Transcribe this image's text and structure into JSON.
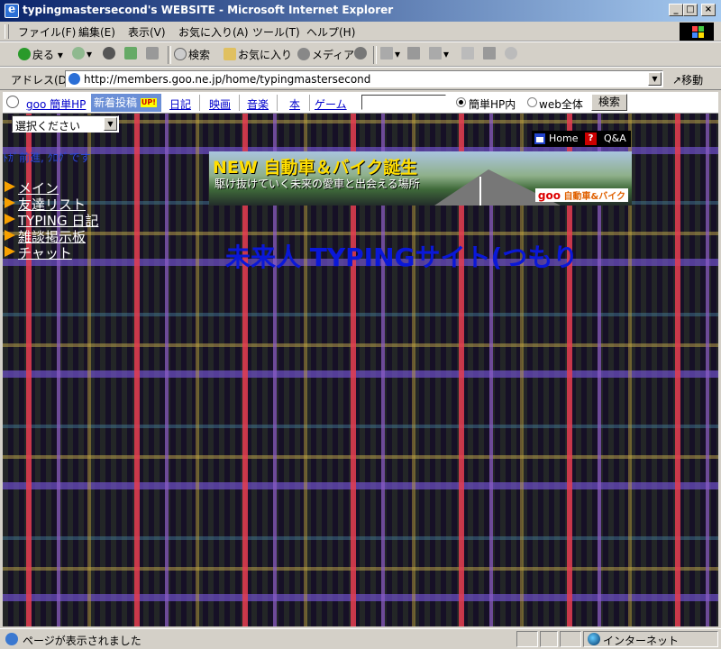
{
  "window": {
    "title": "typingmastersecond's WEBSITE - Microsoft Internet Explorer",
    "controls": [
      "_",
      "□",
      "×"
    ]
  },
  "menu": [
    "ファイル(F)",
    "編集(E)",
    "表示(V)",
    "お気に入り(A)",
    "ツール(T)",
    "ヘルプ(H)"
  ],
  "toolbar": {
    "back": "戻る",
    "search": "検索",
    "favorites": "お気に入り",
    "media": "メディア"
  },
  "address": {
    "label": "アドレス(D)",
    "url": "http://members.goo.ne.jp/home/typingmastersecond",
    "go": "移動"
  },
  "goo_nav": {
    "home_link": "goo 簡単HP",
    "new_posts": "新着投稿",
    "up_badge": "UP!",
    "links": [
      "日記",
      "映画",
      "音楽",
      "本",
      "ゲーム"
    ],
    "search_value": "",
    "radio_site": "簡単HP内",
    "radio_web": "web全体",
    "search_button": "検索"
  },
  "page": {
    "select_value": "選択ください",
    "marquee": "ﾄｶﾞ前進, ｸﾛｸﾞです",
    "side_menu": [
      "メイン",
      "友達リスト",
      "TYPING 日記",
      "雑談掲示板",
      "チャット"
    ],
    "home_link": "Home",
    "qa_link": "Q&A",
    "banner": {
      "headline": "NEW 自動車＆バイク誕生",
      "subline": "駆け抜けていく未来の愛車と出会える場所",
      "brand_goo": "goo",
      "brand_text": "自動車&バイク"
    },
    "site_title": "未来人 TYPINGサイト(つもり"
  },
  "status": {
    "text": "ページが表示されました",
    "zone": "インターネット"
  }
}
